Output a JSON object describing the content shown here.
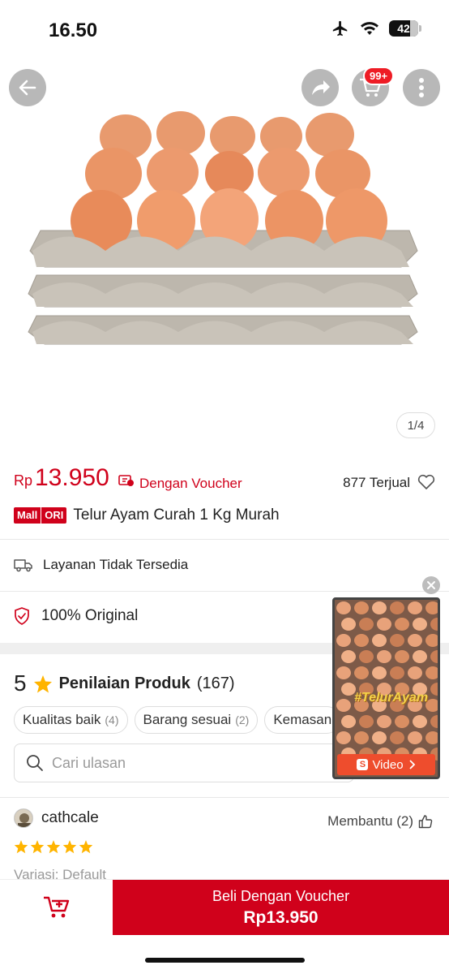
{
  "status_bar": {
    "time": "16.50",
    "battery": "42"
  },
  "header": {
    "cart_badge": "99+"
  },
  "gallery": {
    "page_indicator": "1/4"
  },
  "price": {
    "currency": "Rp",
    "value": "13.950",
    "voucher_text": "Dengan Voucher",
    "sold": "877 Terjual"
  },
  "product": {
    "badge_mall": "Mall",
    "badge_ori": "ORI",
    "title": "Telur Ayam Curah 1 Kg Murah"
  },
  "shipping": {
    "text": "Layanan Tidak Tersedia"
  },
  "guarantee": {
    "text": "100% Original"
  },
  "ratings": {
    "score": "5",
    "title": "Penilaian Produk",
    "count": "(167)",
    "chips": [
      {
        "label": "Kualitas baik",
        "count": "(4)"
      },
      {
        "label": "Barang sesuai",
        "count": "(2)"
      },
      {
        "label": "Kemasan",
        "count": ""
      }
    ],
    "search_placeholder": "Cari ulasan"
  },
  "review": {
    "name": "cathcale",
    "helpful": "Membantu (2)",
    "stars": 5,
    "variant": "Variasi: Default"
  },
  "video": {
    "tag": "#TelurAyam",
    "button": "Video"
  },
  "bottom": {
    "buy_label": "Beli Dengan Voucher",
    "buy_price": "Rp13.950"
  },
  "colors": {
    "accent": "#d0011b",
    "shopee_orange": "#ee4d2d"
  }
}
